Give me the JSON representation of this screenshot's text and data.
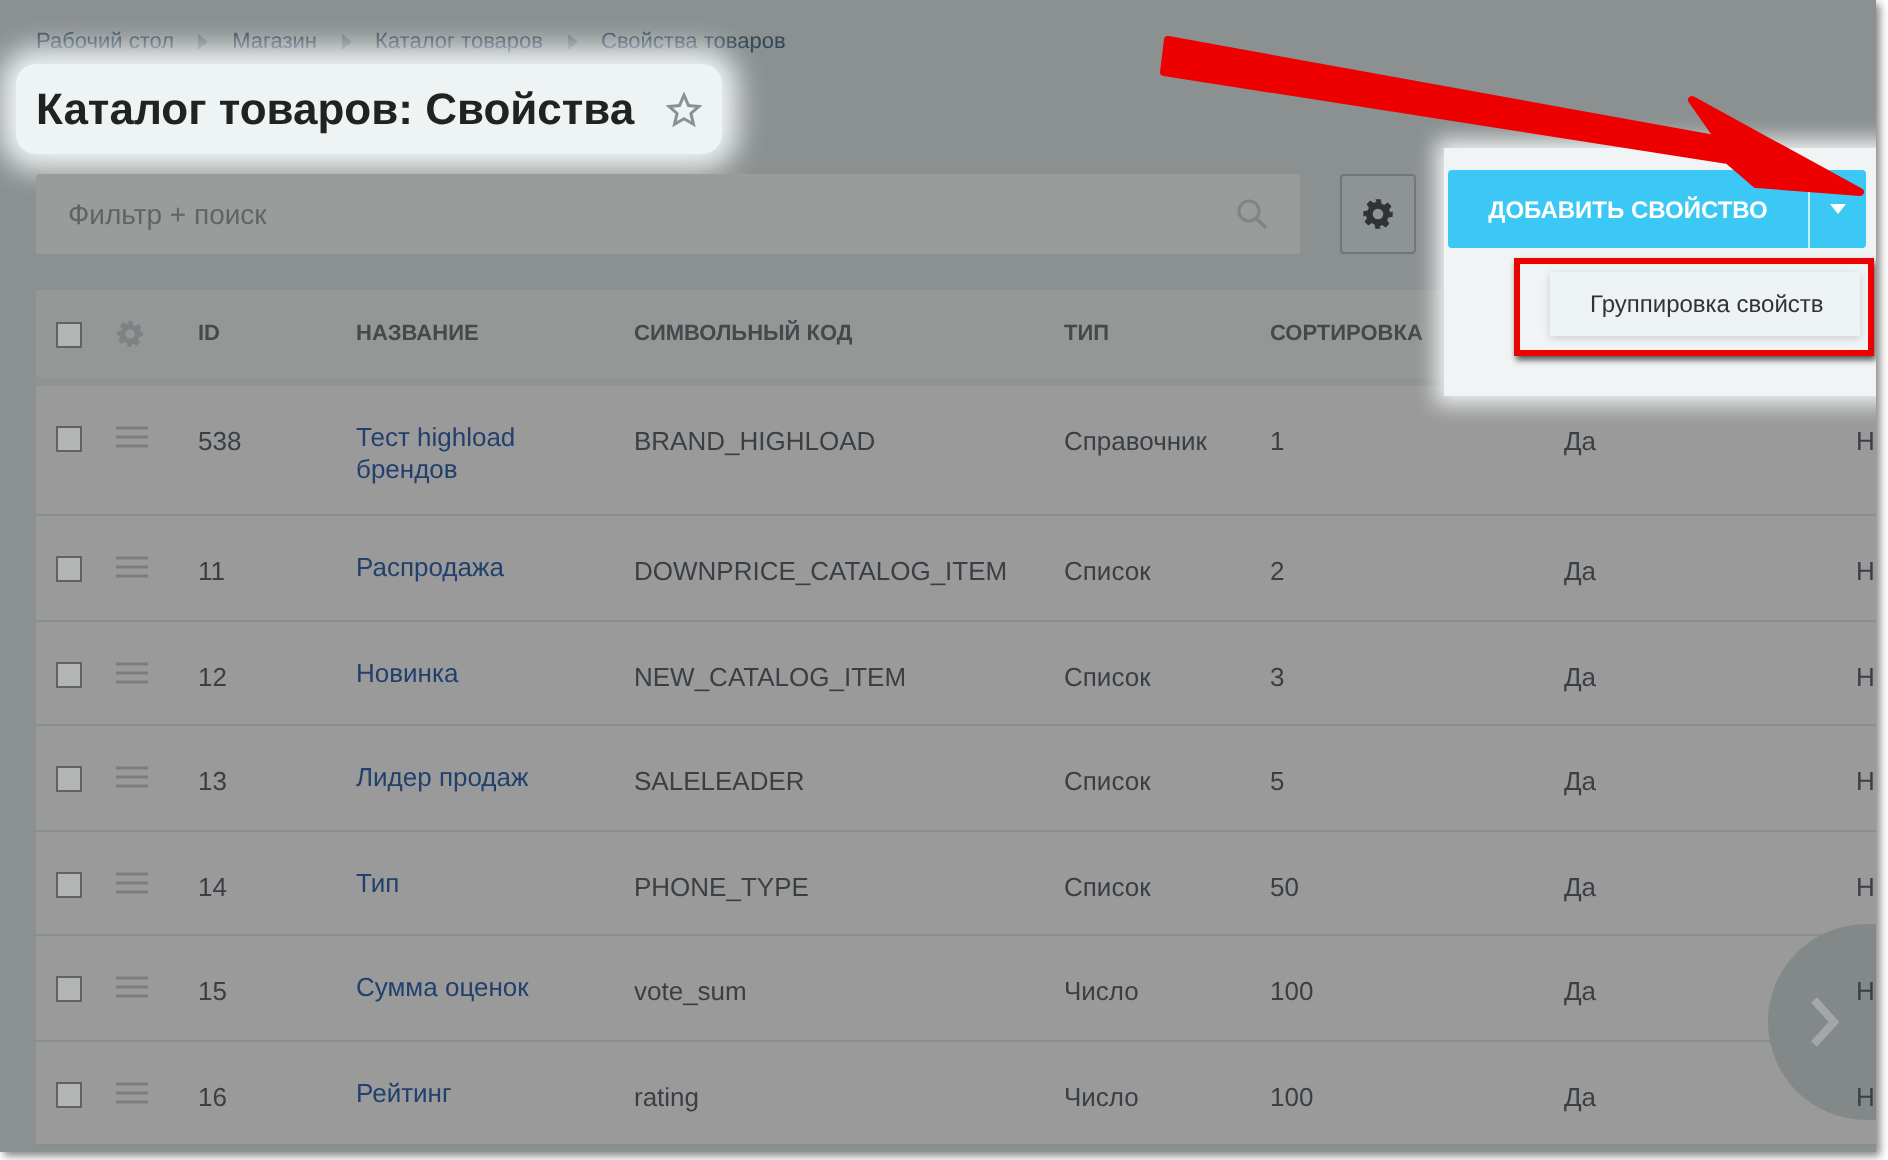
{
  "breadcrumbs": [
    "Рабочий стол",
    "Магазин",
    "Каталог товаров",
    "Свойства товаров"
  ],
  "title": "Каталог товаров: Свойства",
  "favorite": false,
  "filter": {
    "placeholder": "Фильтр + поиск"
  },
  "add_button": {
    "label": "ДОБАВИТЬ СВОЙСТВО"
  },
  "add_menu": {
    "expanded": true,
    "items": [
      "Группировка свойств"
    ]
  },
  "table": {
    "select_all_checked": false,
    "columns": [
      "ID",
      "НАЗВАНИЕ",
      "СИМВОЛЬНЫЙ КОД",
      "ТИП",
      "СОРТИРОВКА"
    ],
    "rows": [
      {
        "id": "538",
        "name": "Тест highload брендов",
        "code": "BRAND_HIGHLOAD",
        "type": "Справочник",
        "sort": "1",
        "column_6": "Да",
        "column_7": "Н",
        "checked": false
      },
      {
        "id": "11",
        "name": "Распродажа",
        "code": "DOWNPRICE_CATALOG_ITEM",
        "type": "Список",
        "sort": "2",
        "column_6": "Да",
        "column_7": "Н",
        "checked": false
      },
      {
        "id": "12",
        "name": "Новинка",
        "code": "NEW_CATALOG_ITEM",
        "type": "Список",
        "sort": "3",
        "column_6": "Да",
        "column_7": "Н",
        "checked": false
      },
      {
        "id": "13",
        "name": "Лидер продаж",
        "code": "SALELEADER",
        "type": "Список",
        "sort": "5",
        "column_6": "Да",
        "column_7": "Н",
        "checked": false
      },
      {
        "id": "14",
        "name": "Тип",
        "code": "PHONE_TYPE",
        "type": "Список",
        "sort": "50",
        "column_6": "Да",
        "column_7": "Н",
        "checked": false
      },
      {
        "id": "15",
        "name": "Сумма оценок",
        "code": "vote_sum",
        "type": "Число",
        "sort": "100",
        "column_6": "Да",
        "column_7": "Н",
        "checked": false
      },
      {
        "id": "16",
        "name": "Рейтинг",
        "code": "rating",
        "type": "Число",
        "sort": "100",
        "column_6": "Да",
        "column_7": "Н",
        "checked": false
      }
    ]
  }
}
